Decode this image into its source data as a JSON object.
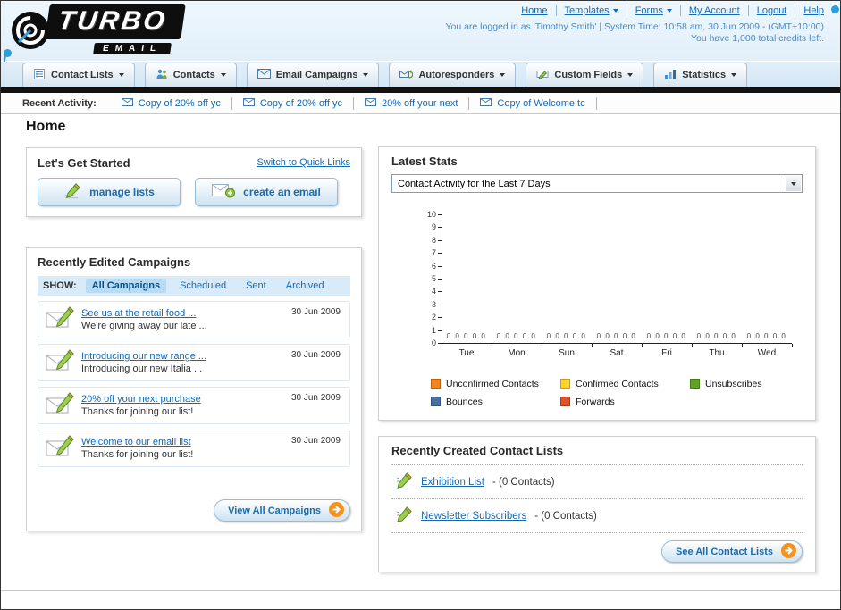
{
  "header": {
    "logo_title": "TURBO",
    "logo_subtitle": "EMAIL",
    "links": [
      {
        "label": "Home",
        "dropdown": false
      },
      {
        "label": "Templates",
        "dropdown": true
      },
      {
        "label": "Forms",
        "dropdown": true
      },
      {
        "label": "My Account",
        "dropdown": false
      },
      {
        "label": "Logout",
        "dropdown": false
      },
      {
        "label": "Help",
        "dropdown": false
      }
    ],
    "login_info": "You are logged in as 'Timothy Smith' | System Time: 10:58 am, 30 Jun 2009 - (GMT+10:00)",
    "credits_info": "You have 1,000 total credits left."
  },
  "nav": {
    "tabs": [
      {
        "label": "Contact Lists"
      },
      {
        "label": "Contacts"
      },
      {
        "label": "Email Campaigns"
      },
      {
        "label": "Autoresponders"
      },
      {
        "label": "Custom Fields"
      },
      {
        "label": "Statistics"
      }
    ]
  },
  "recent_activity": {
    "label": "Recent Activity:",
    "items": [
      {
        "text": "Copy of 20% off yc"
      },
      {
        "text": "Copy of 20% off yc"
      },
      {
        "text": "20% off your next"
      },
      {
        "text": "Copy of Welcome tc"
      }
    ]
  },
  "page": {
    "title": "Home"
  },
  "get_started": {
    "title": "Let's Get Started",
    "switch_link": "Switch to Quick Links",
    "manage_lists_label": "manage lists",
    "create_email_label": "create an email"
  },
  "campaigns": {
    "title": "Recently Edited Campaigns",
    "show_label": "SHOW:",
    "filters": [
      {
        "label": "All Campaigns",
        "active": true
      },
      {
        "label": "Scheduled",
        "active": false
      },
      {
        "label": "Sent",
        "active": false
      },
      {
        "label": "Archived",
        "active": false
      }
    ],
    "items": [
      {
        "title": "See us at the retail food ...",
        "subtitle": "We're giving away our late ...",
        "date": "30 Jun 2009"
      },
      {
        "title": "Introducing our new range ...",
        "subtitle": "Introducing our new Italia ...",
        "date": "30 Jun 2009"
      },
      {
        "title": "20% off your next purchase",
        "subtitle": "Thanks for joining our list!",
        "date": "30 Jun 2009"
      },
      {
        "title": "Welcome to our email list",
        "subtitle": "Thanks for joining our list!",
        "date": "30 Jun 2009"
      }
    ],
    "view_all_label": "View All Campaigns"
  },
  "stats": {
    "title": "Latest Stats",
    "selected_option": "Contact Activity for the Last 7 Days"
  },
  "chart_data": {
    "type": "bar",
    "title": "Contact Activity for the Last 7 Days",
    "categories": [
      "Tue",
      "Mon",
      "Sun",
      "Sat",
      "Fri",
      "Thu",
      "Wed"
    ],
    "series": [
      {
        "name": "Unconfirmed Contacts",
        "color": "#F5821F",
        "values": [
          0,
          0,
          0,
          0,
          0,
          0,
          0
        ]
      },
      {
        "name": "Confirmed Contacts",
        "color": "#FFD42A",
        "values": [
          0,
          0,
          0,
          0,
          0,
          0,
          0
        ]
      },
      {
        "name": "Unsubscribes",
        "color": "#5FA321",
        "values": [
          0,
          0,
          0,
          0,
          0,
          0,
          0
        ]
      },
      {
        "name": "Bounces",
        "color": "#4A70A0",
        "values": [
          0,
          0,
          0,
          0,
          0,
          0,
          0
        ]
      },
      {
        "name": "Forwards",
        "color": "#E2502A",
        "values": [
          0,
          0,
          0,
          0,
          0,
          0,
          0
        ]
      }
    ],
    "ylim": [
      0,
      10
    ],
    "yticks": [
      0,
      1,
      2,
      3,
      4,
      5,
      6,
      7,
      8,
      9,
      10
    ],
    "xlabel": "",
    "ylabel": "",
    "grid": false,
    "legend_position": "bottom"
  },
  "contact_lists": {
    "title": "Recently Created Contact Lists",
    "items": [
      {
        "name": "Exhibition List",
        "detail": "- (0 Contacts)"
      },
      {
        "name": "Newsletter Subscribers",
        "detail": "- (0 Contacts)"
      }
    ],
    "see_all_label": "See All Contact Lists"
  },
  "icons": {
    "speedometer-logo-icon": "gauge",
    "envelope-icon": "✉",
    "pencil-icon": "✎",
    "plus-icon": "+",
    "arrow-right-circle-icon": "➜",
    "chevron-down-icon": "▾",
    "list-icon": "≡",
    "contacts-icon": "people",
    "statistics-icon": "bars"
  },
  "colors": {
    "accent_blue": "#1569b3",
    "header_bg": "#e9f3fb",
    "black_bar": "#121212",
    "filter_bar_bg": "#d9ebf9",
    "orange": "#F6921E"
  }
}
